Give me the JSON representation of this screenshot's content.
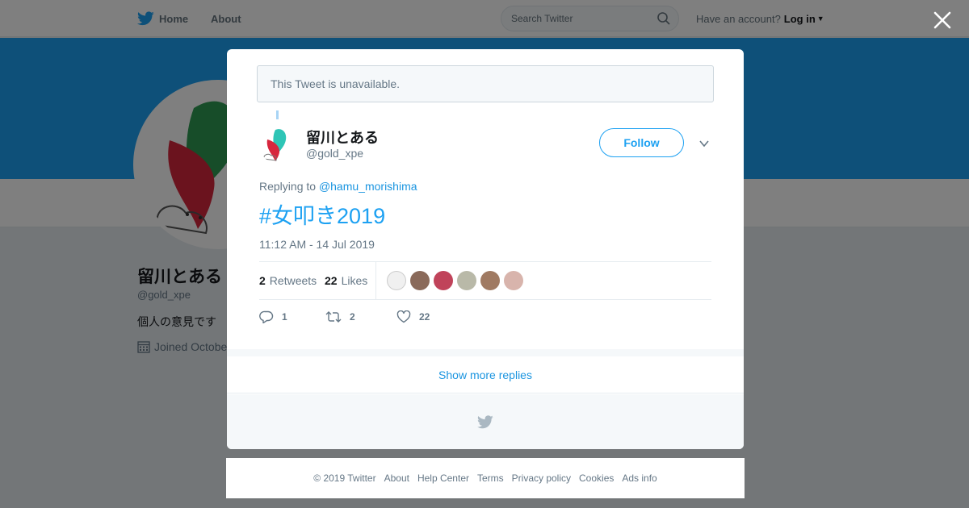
{
  "header": {
    "home_label": "Home",
    "about_label": "About",
    "search_placeholder": "Search Twitter",
    "account_prompt": "Have an account?",
    "login_label": "Log in"
  },
  "profile": {
    "name": "留川とある",
    "handle": "@gold_xpe",
    "bio": "個人の意見です",
    "joined": "Joined Octobe"
  },
  "tweet": {
    "unavailable_text": "This Tweet is unavailable.",
    "author_name": "留川とある",
    "author_handle": "@gold_xpe",
    "follow_label": "Follow",
    "replying_prefix": "Replying to",
    "replying_to": "@hamu_morishima",
    "text": "#女叩き2019",
    "timestamp": "11:12 AM - 14 Jul 2019",
    "retweets_count": "2",
    "retweets_label": "Retweets",
    "likes_count": "22",
    "likes_label": "Likes",
    "reply_count": "1",
    "retweet_count": "2",
    "like_count": "22",
    "show_more_label": "Show more replies"
  },
  "footer": {
    "copyright": "© 2019 Twitter",
    "about": "About",
    "help": "Help Center",
    "terms": "Terms",
    "privacy": "Privacy policy",
    "cookies": "Cookies",
    "ads": "Ads info"
  },
  "colors": {
    "brand_blue": "#1da1f2",
    "link_blue": "#1b95e0",
    "banner": "#1da1f2"
  }
}
